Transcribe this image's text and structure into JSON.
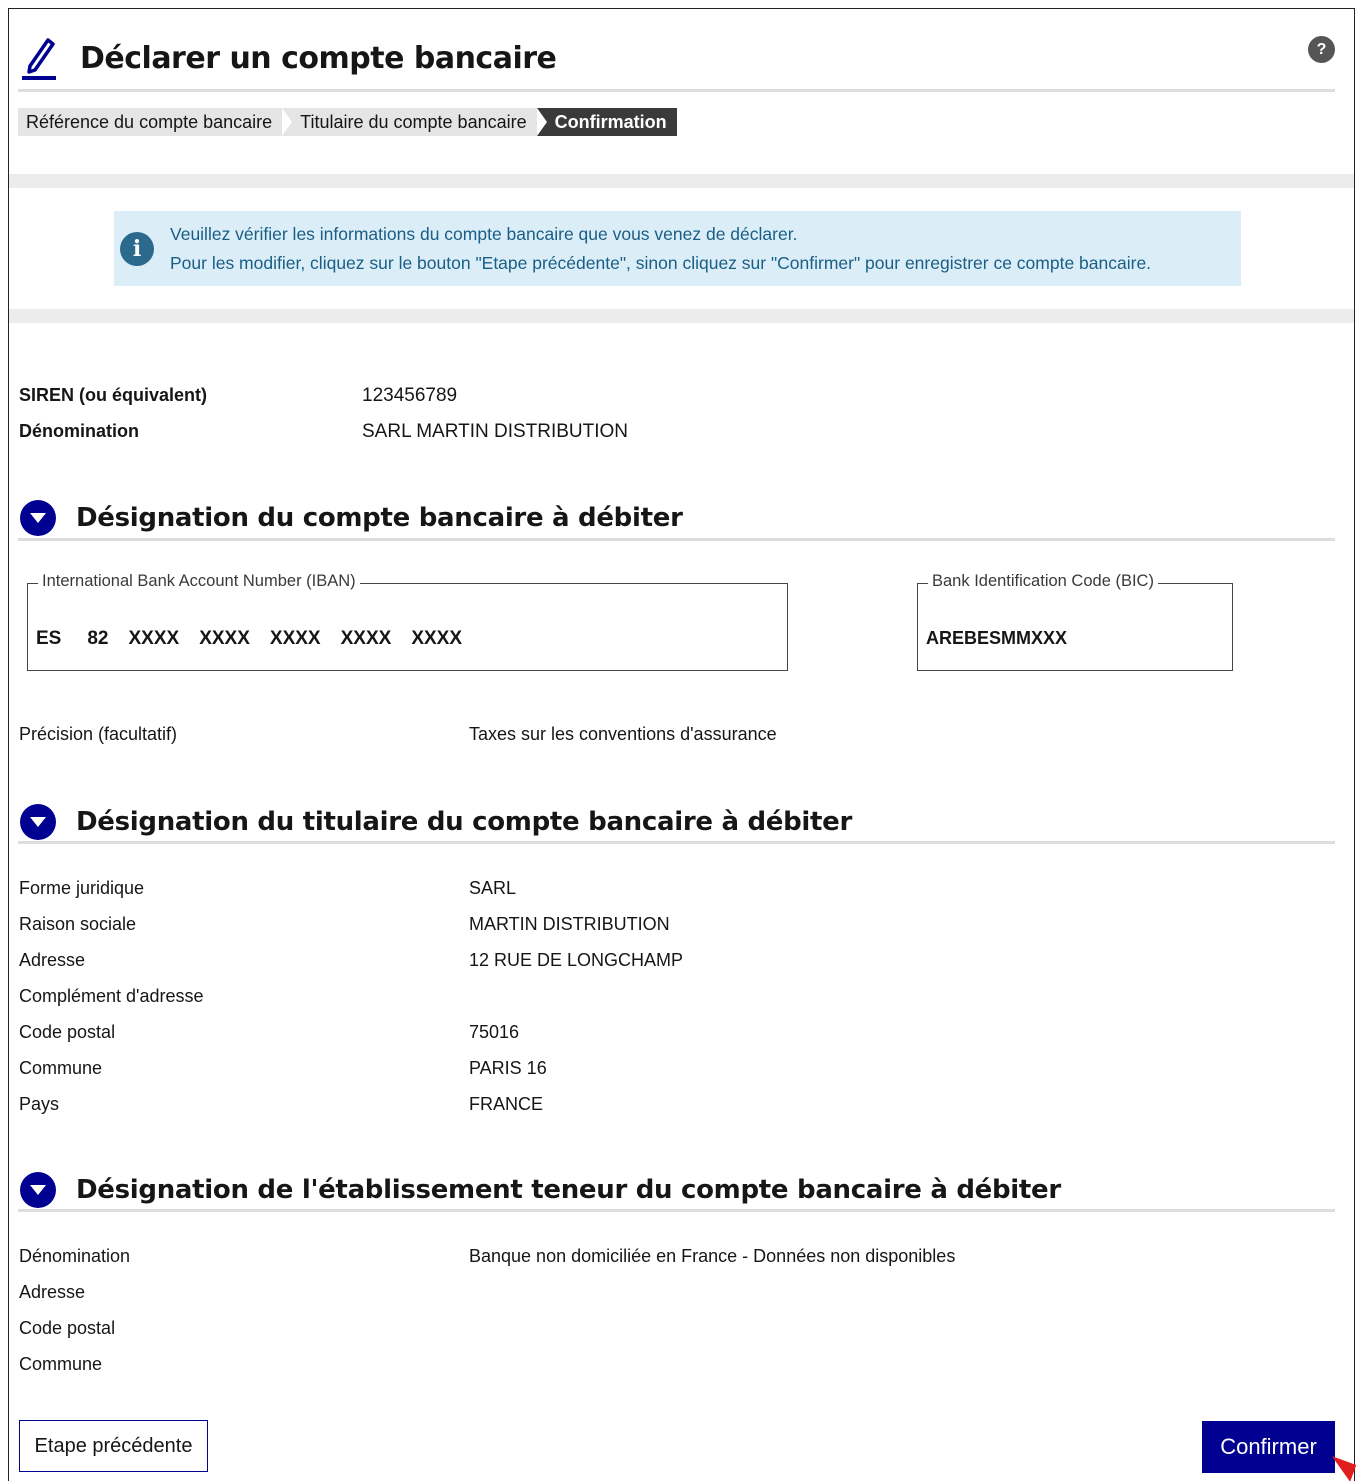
{
  "header": {
    "title": "Déclarer un compte bancaire",
    "help": "?"
  },
  "steps": [
    {
      "label": "Référence du compte bancaire"
    },
    {
      "label": "Titulaire du compte bancaire"
    },
    {
      "label": "Confirmation"
    }
  ],
  "info": {
    "line1": "Veuillez vérifier les informations du compte bancaire que vous venez de déclarer.",
    "line2": "Pour les modifier, cliquez sur le bouton \"Etape précédente\", sinon cliquez sur \"Confirmer\" pour enregistrer ce compte bancaire."
  },
  "company": {
    "siren_label": "SIREN (ou équivalent)",
    "siren_value": "123456789",
    "denom_label": "Dénomination",
    "denom_value": "SARL MARTIN DISTRIBUTION"
  },
  "section_account": {
    "title": "Désignation du compte bancaire à débiter",
    "iban_legend": "International Bank Account Number (IBAN)",
    "iban_parts": [
      "ES",
      "82",
      "XXXX",
      "XXXX",
      "XXXX",
      "XXXX",
      "XXXX"
    ],
    "bic_legend": "Bank Identification Code (BIC)",
    "bic_value": "AREBESMMXXX",
    "precision_label": "Précision (facultatif)",
    "precision_value": "Taxes sur les conventions d'assurance"
  },
  "section_holder": {
    "title": "Désignation du titulaire du compte bancaire à débiter",
    "rows": [
      {
        "label": "Forme juridique",
        "value": "SARL"
      },
      {
        "label": "Raison sociale",
        "value": "MARTIN DISTRIBUTION"
      },
      {
        "label": "Adresse",
        "value": "12 RUE DE LONGCHAMP"
      },
      {
        "label": "Complément d'adresse",
        "value": ""
      },
      {
        "label": "Code postal",
        "value": "75016"
      },
      {
        "label": "Commune",
        "value": "PARIS 16"
      },
      {
        "label": "Pays",
        "value": "FRANCE"
      }
    ]
  },
  "section_bank": {
    "title": "Désignation de l'établissement teneur du compte bancaire à débiter",
    "rows": [
      {
        "label": "Dénomination",
        "value": "Banque non domiciliée en France - Données non disponibles"
      },
      {
        "label": "Adresse",
        "value": ""
      },
      {
        "label": "Code postal",
        "value": ""
      },
      {
        "label": "Commune",
        "value": ""
      }
    ]
  },
  "buttons": {
    "prev": "Etape précédente",
    "confirm": "Confirmer"
  },
  "colors": {
    "primary": "#000091",
    "info_bg": "#dbeef8",
    "info_text": "#1a5e86"
  }
}
